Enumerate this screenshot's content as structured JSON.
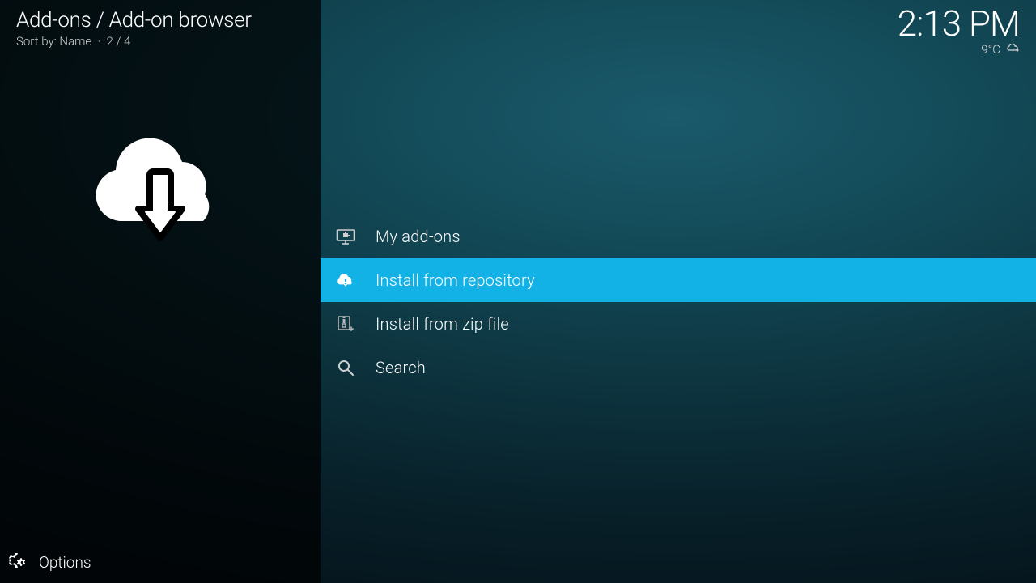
{
  "header": {
    "breadcrumb": "Add-ons / Add-on browser",
    "sort_by_label": "Sort by: Name",
    "count_label": "2 / 4"
  },
  "clock": "2:13 PM",
  "weather": {
    "temp": "9°C",
    "condition_icon": "cloudy-arrow"
  },
  "menu": {
    "items": [
      {
        "label": "My add-ons",
        "icon": "monitor-addon-icon",
        "selected": false
      },
      {
        "label": "Install from repository",
        "icon": "cloud-download-icon",
        "selected": true
      },
      {
        "label": "Install from zip file",
        "icon": "zip-download-icon",
        "selected": false
      },
      {
        "label": "Search",
        "icon": "search-icon",
        "selected": false
      }
    ]
  },
  "footer": {
    "options_label": "Options"
  },
  "colors": {
    "accent": "#12b2e7"
  }
}
